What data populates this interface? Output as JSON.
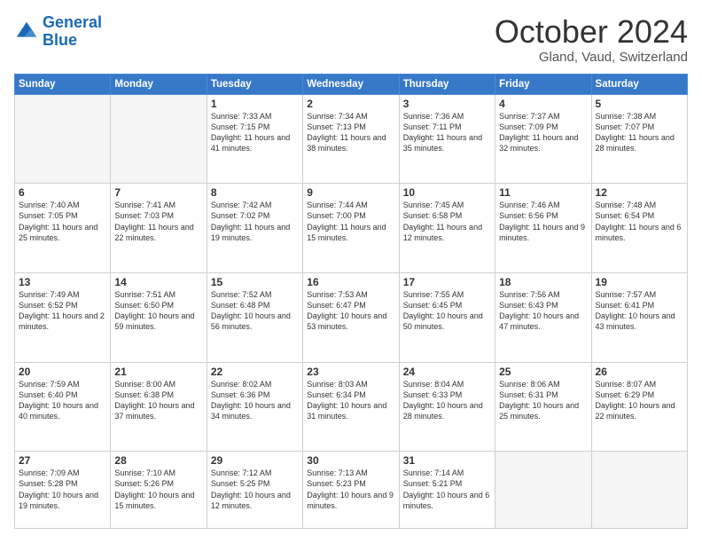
{
  "logo": {
    "line1": "General",
    "line2": "Blue"
  },
  "header": {
    "title": "October 2024",
    "subtitle": "Gland, Vaud, Switzerland"
  },
  "weekdays": [
    "Sunday",
    "Monday",
    "Tuesday",
    "Wednesday",
    "Thursday",
    "Friday",
    "Saturday"
  ],
  "weeks": [
    [
      {
        "day": "",
        "info": ""
      },
      {
        "day": "",
        "info": ""
      },
      {
        "day": "1",
        "info": "Sunrise: 7:33 AM\nSunset: 7:15 PM\nDaylight: 11 hours and 41 minutes."
      },
      {
        "day": "2",
        "info": "Sunrise: 7:34 AM\nSunset: 7:13 PM\nDaylight: 11 hours and 38 minutes."
      },
      {
        "day": "3",
        "info": "Sunrise: 7:36 AM\nSunset: 7:11 PM\nDaylight: 11 hours and 35 minutes."
      },
      {
        "day": "4",
        "info": "Sunrise: 7:37 AM\nSunset: 7:09 PM\nDaylight: 11 hours and 32 minutes."
      },
      {
        "day": "5",
        "info": "Sunrise: 7:38 AM\nSunset: 7:07 PM\nDaylight: 11 hours and 28 minutes."
      }
    ],
    [
      {
        "day": "6",
        "info": "Sunrise: 7:40 AM\nSunset: 7:05 PM\nDaylight: 11 hours and 25 minutes."
      },
      {
        "day": "7",
        "info": "Sunrise: 7:41 AM\nSunset: 7:03 PM\nDaylight: 11 hours and 22 minutes."
      },
      {
        "day": "8",
        "info": "Sunrise: 7:42 AM\nSunset: 7:02 PM\nDaylight: 11 hours and 19 minutes."
      },
      {
        "day": "9",
        "info": "Sunrise: 7:44 AM\nSunset: 7:00 PM\nDaylight: 11 hours and 15 minutes."
      },
      {
        "day": "10",
        "info": "Sunrise: 7:45 AM\nSunset: 6:58 PM\nDaylight: 11 hours and 12 minutes."
      },
      {
        "day": "11",
        "info": "Sunrise: 7:46 AM\nSunset: 6:56 PM\nDaylight: 11 hours and 9 minutes."
      },
      {
        "day": "12",
        "info": "Sunrise: 7:48 AM\nSunset: 6:54 PM\nDaylight: 11 hours and 6 minutes."
      }
    ],
    [
      {
        "day": "13",
        "info": "Sunrise: 7:49 AM\nSunset: 6:52 PM\nDaylight: 11 hours and 2 minutes."
      },
      {
        "day": "14",
        "info": "Sunrise: 7:51 AM\nSunset: 6:50 PM\nDaylight: 10 hours and 59 minutes."
      },
      {
        "day": "15",
        "info": "Sunrise: 7:52 AM\nSunset: 6:48 PM\nDaylight: 10 hours and 56 minutes."
      },
      {
        "day": "16",
        "info": "Sunrise: 7:53 AM\nSunset: 6:47 PM\nDaylight: 10 hours and 53 minutes."
      },
      {
        "day": "17",
        "info": "Sunrise: 7:55 AM\nSunset: 6:45 PM\nDaylight: 10 hours and 50 minutes."
      },
      {
        "day": "18",
        "info": "Sunrise: 7:56 AM\nSunset: 6:43 PM\nDaylight: 10 hours and 47 minutes."
      },
      {
        "day": "19",
        "info": "Sunrise: 7:57 AM\nSunset: 6:41 PM\nDaylight: 10 hours and 43 minutes."
      }
    ],
    [
      {
        "day": "20",
        "info": "Sunrise: 7:59 AM\nSunset: 6:40 PM\nDaylight: 10 hours and 40 minutes."
      },
      {
        "day": "21",
        "info": "Sunrise: 8:00 AM\nSunset: 6:38 PM\nDaylight: 10 hours and 37 minutes."
      },
      {
        "day": "22",
        "info": "Sunrise: 8:02 AM\nSunset: 6:36 PM\nDaylight: 10 hours and 34 minutes."
      },
      {
        "day": "23",
        "info": "Sunrise: 8:03 AM\nSunset: 6:34 PM\nDaylight: 10 hours and 31 minutes."
      },
      {
        "day": "24",
        "info": "Sunrise: 8:04 AM\nSunset: 6:33 PM\nDaylight: 10 hours and 28 minutes."
      },
      {
        "day": "25",
        "info": "Sunrise: 8:06 AM\nSunset: 6:31 PM\nDaylight: 10 hours and 25 minutes."
      },
      {
        "day": "26",
        "info": "Sunrise: 8:07 AM\nSunset: 6:29 PM\nDaylight: 10 hours and 22 minutes."
      }
    ],
    [
      {
        "day": "27",
        "info": "Sunrise: 7:09 AM\nSunset: 5:28 PM\nDaylight: 10 hours and 19 minutes."
      },
      {
        "day": "28",
        "info": "Sunrise: 7:10 AM\nSunset: 5:26 PM\nDaylight: 10 hours and 15 minutes."
      },
      {
        "day": "29",
        "info": "Sunrise: 7:12 AM\nSunset: 5:25 PM\nDaylight: 10 hours and 12 minutes."
      },
      {
        "day": "30",
        "info": "Sunrise: 7:13 AM\nSunset: 5:23 PM\nDaylight: 10 hours and 9 minutes."
      },
      {
        "day": "31",
        "info": "Sunrise: 7:14 AM\nSunset: 5:21 PM\nDaylight: 10 hours and 6 minutes."
      },
      {
        "day": "",
        "info": ""
      },
      {
        "day": "",
        "info": ""
      }
    ]
  ]
}
